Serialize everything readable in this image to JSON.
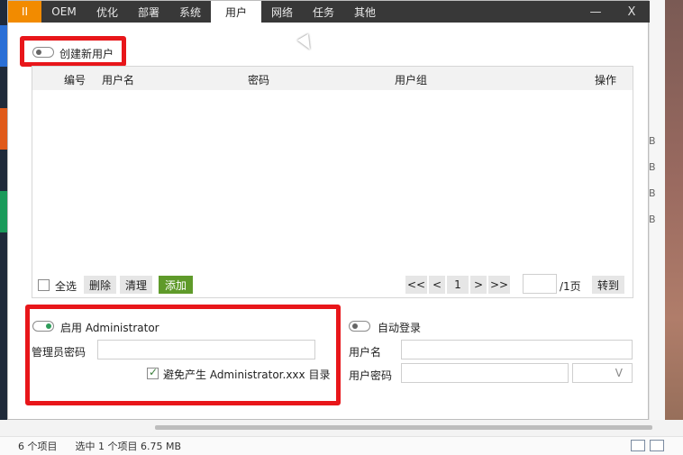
{
  "tabs": [
    {
      "label": "II"
    },
    {
      "label": "OEM"
    },
    {
      "label": "优化"
    },
    {
      "label": "部署"
    },
    {
      "label": "系统"
    },
    {
      "label": "用户",
      "active": true
    },
    {
      "label": "网络"
    },
    {
      "label": "任务"
    },
    {
      "label": "其他"
    }
  ],
  "window_controls": {
    "minimize": "—",
    "close": "X"
  },
  "create_user": {
    "label": "创建新用户",
    "enabled": false
  },
  "table": {
    "columns": [
      "编号",
      "用户名",
      "密码",
      "用户组",
      "操作"
    ],
    "rows": []
  },
  "table_actions": {
    "select_all": "全选",
    "delete": "删除",
    "clear": "清理",
    "add": "添加"
  },
  "pagination": {
    "first": "<<",
    "prev": "<",
    "current": "1",
    "next": ">",
    "last": ">>",
    "page_input": "",
    "total": "/1页",
    "goto": "转到"
  },
  "admin": {
    "toggle_label": "启用 Administrator",
    "enabled": true,
    "password_label": "管理员密码",
    "password_value": "",
    "avoid_dir_label": "避免产生 Administrator.xxx 目录",
    "avoid_dir_checked": true
  },
  "autologin": {
    "toggle_label": "自动登录",
    "enabled": false,
    "username_label": "用户名",
    "username_value": "",
    "password_label": "用户密码",
    "password_value": "",
    "dropdown_value": "V"
  },
  "explorer_status": {
    "items": "6 个项目",
    "selected": "选中 1 个项目  6.75 MB"
  },
  "bg_sizes": [
    "B",
    "B",
    "B",
    "B"
  ],
  "colors": {
    "accent_orange": "#f28b00",
    "tabbar": "#383838",
    "add_green": "#5f9a2a",
    "highlight_red": "#e8161a",
    "toggle_on": "#2e9c5a"
  }
}
